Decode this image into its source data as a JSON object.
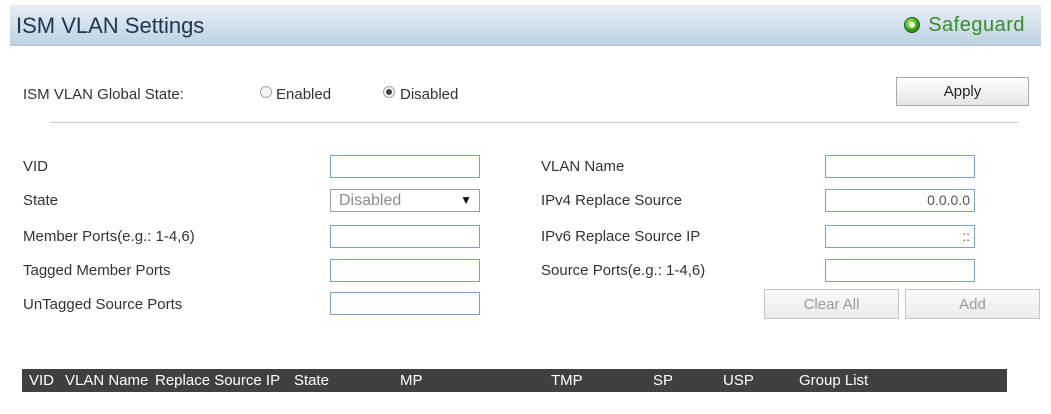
{
  "header": {
    "title": "ISM VLAN Settings",
    "safeguard_label": "Safeguard",
    "safeguard_icon": "safeguard-status-icon",
    "safeguard_color": "#3aa51c"
  },
  "global_state": {
    "label": "ISM VLAN Global State:",
    "options": [
      "Enabled",
      "Disabled"
    ],
    "selected": "Disabled",
    "apply_label": "Apply"
  },
  "form": {
    "left": [
      {
        "label": "VID",
        "type": "input",
        "value": ""
      },
      {
        "label": "State",
        "type": "select",
        "value": "Disabled"
      },
      {
        "label": "Member Ports(e.g.: 1-4,6)",
        "type": "input",
        "value": ""
      },
      {
        "label": "Tagged Member Ports",
        "type": "input",
        "value": ""
      },
      {
        "label": "UnTagged Source Ports",
        "type": "input",
        "value": ""
      }
    ],
    "right": [
      {
        "label": "VLAN Name",
        "type": "input",
        "value": ""
      },
      {
        "label": "IPv4 Replace Source",
        "type": "input",
        "value": "0.0.0.0"
      },
      {
        "label": "IPv6 Replace Source IP",
        "type": "input",
        "value": "::"
      },
      {
        "label": "Source Ports(e.g.: 1-4,6)",
        "type": "input",
        "value": ""
      }
    ],
    "clear_all_label": "Clear All",
    "add_label": "Add"
  },
  "table": {
    "columns": [
      "VID",
      "VLAN Name",
      "Replace Source IP",
      "State",
      "MP",
      "TMP",
      "SP",
      "USP",
      "Group List"
    ],
    "header_bg": "#404040"
  }
}
